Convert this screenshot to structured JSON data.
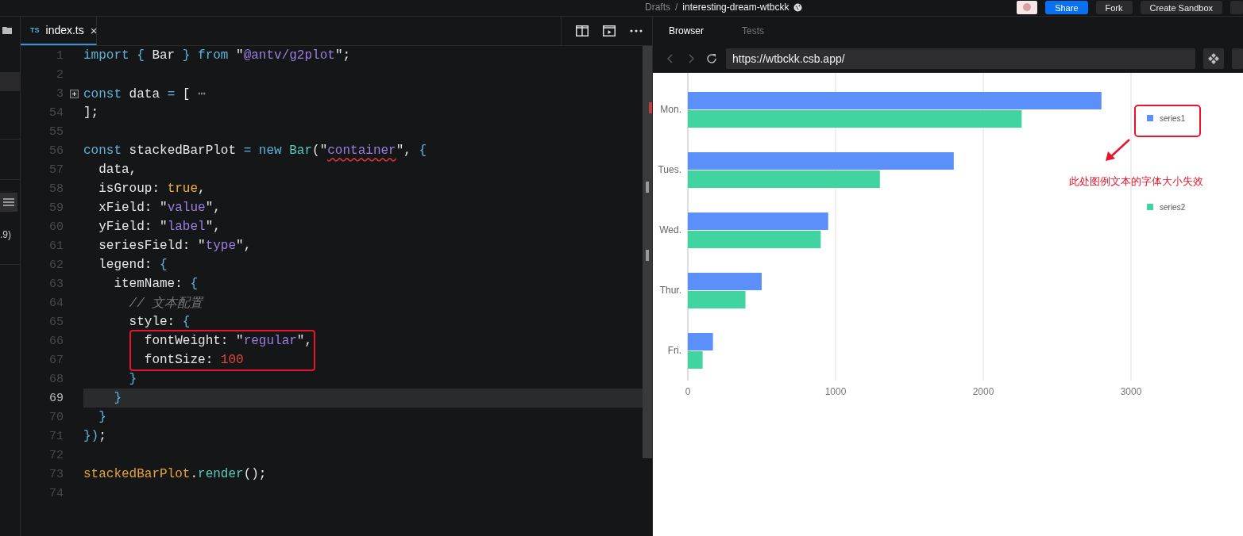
{
  "topbar": {
    "breadcrumb": [
      "Drafts",
      "/",
      "interesting-dream-wtbckk"
    ],
    "buttons": [
      {
        "label": "Share",
        "kind": "primary"
      },
      {
        "label": "Fork",
        "kind": "plain"
      },
      {
        "label": "Create Sandbox",
        "kind": "plain"
      }
    ]
  },
  "sidebar": {
    "text": ".9)"
  },
  "editor": {
    "tabs": [
      {
        "badge": "TS",
        "label": "index.ts",
        "close": "×",
        "selected": true
      }
    ],
    "lines": [
      {
        "n": "1",
        "current": false,
        "t": [
          {
            "kind": "kw",
            "text": "import"
          },
          {
            "kind": "kw",
            "text": " {"
          },
          {
            "kind": "id",
            "text": " Bar "
          },
          {
            "kind": "kw",
            "text": "}"
          },
          {
            "kind": "kw",
            "text": " from"
          },
          {
            "kind": "id",
            "text": " \""
          },
          {
            "kind": "str",
            "text": "@antv/g2plot"
          },
          {
            "kind": "id",
            "text": "\";"
          }
        ]
      },
      {
        "n": "2",
        "current": false
      },
      {
        "n": "3",
        "current": false,
        "fold": true,
        "t": [
          {
            "kind": "kw",
            "text": "const"
          },
          {
            "kind": "id",
            "text": " data "
          },
          {
            "kind": "kw",
            "text": "="
          },
          {
            "kind": "id",
            "text": " ["
          },
          {
            "kind": "dim",
            "text": " ⋯"
          }
        ]
      },
      {
        "n": "54",
        "current": false,
        "t": [
          {
            "kind": "id",
            "text": "];"
          }
        ]
      },
      {
        "n": "55",
        "current": false
      },
      {
        "n": "56",
        "current": false,
        "t": [
          {
            "kind": "kw",
            "text": "const"
          },
          {
            "kind": "id",
            "text": " stackedBarPlot "
          },
          {
            "kind": "kw",
            "text": "="
          },
          {
            "kind": "kw",
            "text": " new"
          },
          {
            "kind": "fn",
            "text": " Bar"
          },
          {
            "kind": "id",
            "text": "(\""
          },
          {
            "kind": "err",
            "text": "container"
          },
          {
            "kind": "id",
            "text": "\","
          },
          {
            "kind": "kw",
            "text": " {"
          }
        ]
      },
      {
        "n": "57",
        "current": false,
        "t": [
          {
            "kind": "id",
            "text": "  data,"
          }
        ]
      },
      {
        "n": "58",
        "current": false,
        "t": [
          {
            "kind": "id",
            "text": "  isGroup: "
          },
          {
            "kind": "bool",
            "text": "true"
          },
          {
            "kind": "id",
            "text": ","
          }
        ]
      },
      {
        "n": "59",
        "current": false,
        "t": [
          {
            "kind": "id",
            "text": "  xField: \""
          },
          {
            "kind": "str",
            "text": "value"
          },
          {
            "kind": "id",
            "text": "\","
          }
        ]
      },
      {
        "n": "60",
        "current": false,
        "t": [
          {
            "kind": "id",
            "text": "  yField: \""
          },
          {
            "kind": "str",
            "text": "label"
          },
          {
            "kind": "id",
            "text": "\","
          }
        ]
      },
      {
        "n": "61",
        "current": false,
        "t": [
          {
            "kind": "id",
            "text": "  seriesField: \""
          },
          {
            "kind": "str",
            "text": "type"
          },
          {
            "kind": "id",
            "text": "\","
          }
        ]
      },
      {
        "n": "62",
        "current": false,
        "t": [
          {
            "kind": "id",
            "text": "  legend: "
          },
          {
            "kind": "kw",
            "text": "{"
          }
        ]
      },
      {
        "n": "63",
        "current": false,
        "t": [
          {
            "kind": "id",
            "text": "    itemName: "
          },
          {
            "kind": "kw",
            "text": "{"
          }
        ]
      },
      {
        "n": "64",
        "current": false,
        "t": [
          {
            "kind": "cm",
            "text": "      // 文本配置"
          }
        ]
      },
      {
        "n": "65",
        "current": false,
        "t": [
          {
            "kind": "id",
            "text": "      style: "
          },
          {
            "kind": "kw",
            "text": "{"
          }
        ]
      },
      {
        "n": "66",
        "current": false,
        "boxed": true,
        "t": [
          {
            "kind": "id",
            "text": "        fontWeight: \""
          },
          {
            "kind": "str",
            "text": "regular"
          },
          {
            "kind": "id",
            "text": "\","
          }
        ]
      },
      {
        "n": "67",
        "current": false,
        "boxed": true,
        "t": [
          {
            "kind": "id",
            "text": "        fontSize: "
          },
          {
            "kind": "num",
            "text": "100"
          }
        ]
      },
      {
        "n": "68",
        "current": false,
        "t": [
          {
            "kind": "kw",
            "text": "      }"
          }
        ]
      },
      {
        "n": "69",
        "current": true,
        "t": [
          {
            "kind": "kw",
            "text": "    }"
          }
        ]
      },
      {
        "n": "70",
        "current": false,
        "t": [
          {
            "kind": "kw",
            "text": "  }"
          }
        ]
      },
      {
        "n": "71",
        "current": false,
        "t": [
          {
            "kind": "kw",
            "text": "})"
          },
          {
            "kind": "id",
            "text": ";"
          }
        ]
      },
      {
        "n": "72",
        "current": false
      },
      {
        "n": "73",
        "current": false,
        "t": [
          {
            "kind": "var",
            "text": "stackedBarPlot"
          },
          {
            "kind": "id",
            "text": "."
          },
          {
            "kind": "fn",
            "text": "render"
          },
          {
            "kind": "id",
            "text": "();"
          }
        ]
      },
      {
        "n": "74",
        "current": false
      }
    ]
  },
  "preview": {
    "tabs": [
      {
        "label": "Browser",
        "selected": true
      },
      {
        "label": "Tests",
        "selected": false
      }
    ],
    "url": "https://wtbckk.csb.app/",
    "chart_data": {
      "type": "bar",
      "orientation": "horizontal",
      "grid": true,
      "legend": true,
      "categories": [
        "Mon.",
        "Tues.",
        "Wed.",
        "Thur.",
        "Fri."
      ],
      "series": [
        {
          "name": "series1",
          "color": "#5b8ff9",
          "values": [
            2800,
            1800,
            950,
            500,
            170
          ]
        },
        {
          "name": "series2",
          "color": "#3fd4a0",
          "values": [
            2260,
            1300,
            900,
            390,
            100
          ]
        }
      ],
      "xlim": [
        0,
        3000
      ],
      "xticks": [
        0,
        1000,
        2000,
        3000
      ]
    },
    "annotation": {
      "text": "此处图例文本的字体大小失效"
    }
  }
}
